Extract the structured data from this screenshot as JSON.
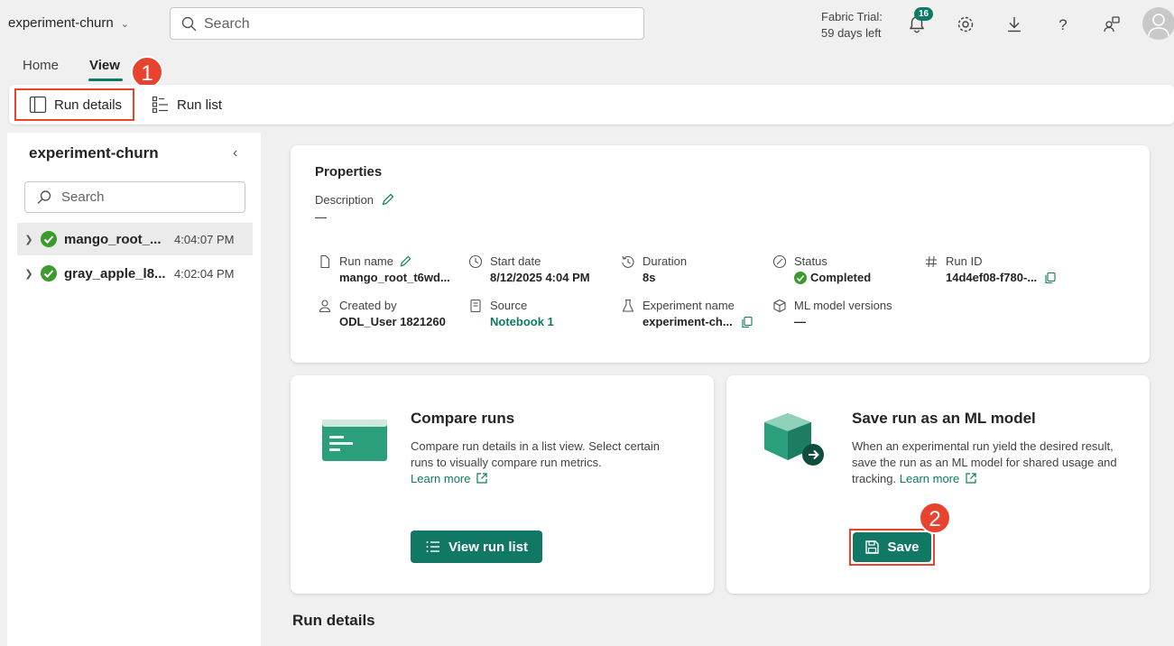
{
  "header": {
    "workspace": "experiment-churn",
    "search_placeholder": "Search",
    "trial_line1": "Fabric Trial:",
    "trial_line2": "59 days left",
    "notifications_count": "16"
  },
  "tabs": [
    {
      "label": "Home"
    },
    {
      "label": "View"
    }
  ],
  "callouts": [
    "1",
    "2"
  ],
  "ribbon": {
    "run_details": "Run details",
    "run_list": "Run list"
  },
  "left_panel": {
    "title": "experiment-churn",
    "search_placeholder": "Search",
    "runs": [
      {
        "name": "mango_root_...",
        "time": "4:04:07 PM",
        "status": "Completed"
      },
      {
        "name": "gray_apple_l8...",
        "time": "4:02:04 PM",
        "status": "Completed"
      }
    ]
  },
  "properties": {
    "title": "Properties",
    "description_label": "Description",
    "description_value": "—",
    "fields": {
      "run_name": {
        "label": "Run name",
        "value": "mango_root_t6wd..."
      },
      "start_date": {
        "label": "Start date",
        "value": "8/12/2025 4:04 PM"
      },
      "duration": {
        "label": "Duration",
        "value": "8s"
      },
      "status": {
        "label": "Status",
        "value": "Completed"
      },
      "run_id": {
        "label": "Run ID",
        "value": "14d4ef08-f780-..."
      },
      "created_by": {
        "label": "Created by",
        "value": "ODL_User 1821260"
      },
      "source": {
        "label": "Source",
        "value": "Notebook 1"
      },
      "experiment_name": {
        "label": "Experiment name",
        "value": "experiment-ch..."
      },
      "ml_model_versions": {
        "label": "ML model versions",
        "value": "—"
      }
    }
  },
  "compare_card": {
    "title": "Compare runs",
    "body": "Compare run details in a list view. Select certain runs to visually compare run metrics.",
    "link": "Learn more",
    "button": "View run list"
  },
  "save_card": {
    "title": "Save run as an ML model",
    "body": "When an experimental run yield the desired result, save the run as an ML model for shared usage and tracking.",
    "link": "Learn more",
    "button": "Save"
  },
  "section": {
    "run_details": "Run details"
  },
  "colors": {
    "accent": "#117865",
    "callout": "#e8432e",
    "success": "#3c9a2e"
  }
}
